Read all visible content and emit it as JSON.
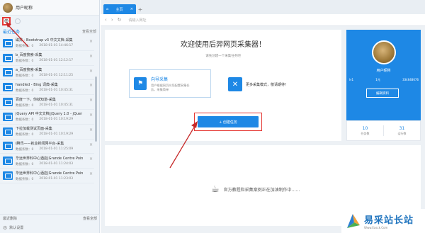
{
  "left_panel": {
    "user_name": "用户昵称",
    "new_task_icon": "new-task-icon",
    "recent_title": "最近任务",
    "view_all": "查看全部",
    "tasks": [
      {
        "title": "磁抹 - Bootstrap v3 中文文档-采集",
        "count_label": "数据条数：0",
        "date": "2018-01-01 14:46:17"
      },
      {
        "title": "b_百度搜索-采集",
        "count_label": "数据条数：0",
        "date": "2018-01-01 12:12:17"
      },
      {
        "title": "a_百度搜索-采集",
        "count_label": "数据条数：0",
        "date": "2018-01-01 12:11:25"
      },
      {
        "title": "handled - Bing 词典-采集",
        "count_label": "数据条数：0",
        "date": "2018-01-01 10:45:31"
      },
      {
        "title": "百度一下，你就知道-采集",
        "count_label": "数据条数：0",
        "date": "2018-01-01 10:45:31"
      },
      {
        "title": "jQuery API 中文文档|jQuery 1.0 - jQuer",
        "count_label": "数据条数：0",
        "date": "2018-01-01 10:19:29"
      },
      {
        "title": "下拉加载测试页面-采集",
        "count_label": "数据条数：0",
        "date": "2018-01-01 10:19:29"
      },
      {
        "title": "i腾讯——就业新闻网平台-采集",
        "count_label": "数据条数：0",
        "date": "2018-01-01 11:25:09"
      },
      {
        "title": "华远世界科中心酒店|Grande Centre Poin",
        "count_label": "数据条数：0",
        "date": "2018-01-01 11:24:03"
      },
      {
        "title": "华远世界科中心酒店|Grande Centre Poin",
        "count_label": "数据条数：0",
        "date": "2018-01-01 11:23:03"
      }
    ],
    "recent_deleted": "最近删除",
    "view_all_2": "查看全部",
    "bottom_settings": "默认设置"
  },
  "browser": {
    "tab_label": "主页",
    "address_placeholder": "请输入网址",
    "nav_icons": [
      "back-icon",
      "forward-icon",
      "refresh-icon"
    ]
  },
  "welcome": {
    "title": "欢迎使用后羿网页采集器！",
    "subtitle": "请先创建一个采集任务吧",
    "guide_title": "向导采集",
    "guide_desc": "用户根据网页向导配置采集任务，采集简单",
    "tools_text": "更多采集模式，敬请期待！",
    "create_button": "+ 创建任务"
  },
  "profile": {
    "name": "用户昵称",
    "level": "lv1",
    "points": "1元",
    "qq": "334648676",
    "edit_button": "编辑资料",
    "stat_left_num": "10",
    "stat_left_label": "任务数",
    "stat_right_num": "31",
    "stat_right_label": "运行数"
  },
  "empty_state": {
    "text": "官方教程和采集案例正在加油制作中……"
  },
  "watermark": {
    "title": "易采站长站",
    "url": "Www.Easck.Com"
  },
  "colors": {
    "accent": "#1e88e5",
    "highlight": "#e53935"
  }
}
